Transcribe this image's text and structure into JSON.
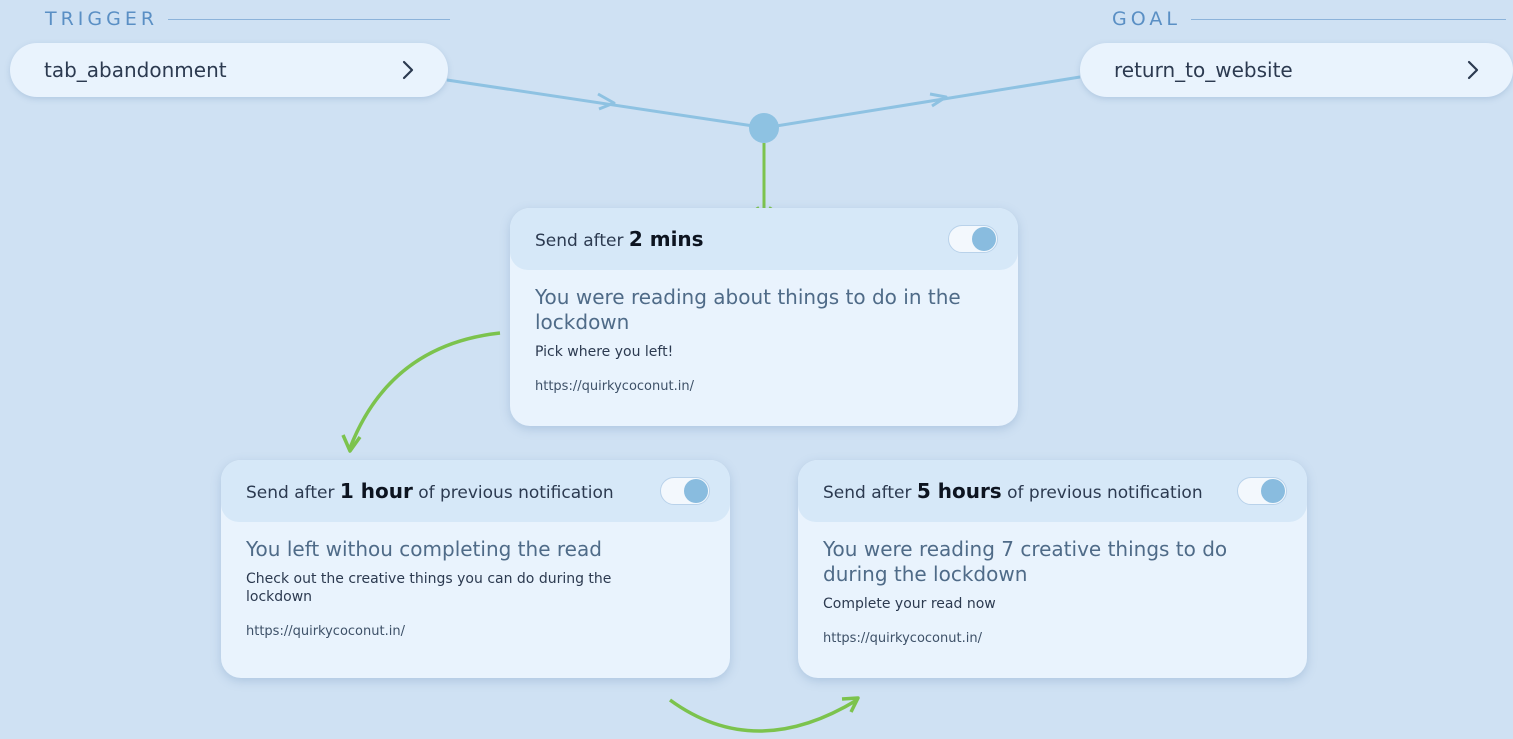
{
  "trigger": {
    "label": "TRIGGER",
    "value": "tab_abandonment"
  },
  "goal": {
    "label": "GOAL",
    "value": "return_to_website"
  },
  "notifications": [
    {
      "prefix": "Send after",
      "delay": "2 mins",
      "suffix": "",
      "title": "You were reading about things to do in the lockdown",
      "message": "Pick where you left!",
      "url": "https://quirkycoconut.in/",
      "enabled": true
    },
    {
      "prefix": "Send after",
      "delay": "1 hour",
      "suffix": "of previous notification",
      "title": "You left withou completing the read",
      "message": "Check out the creative things you can do during the lockdown",
      "url": "https://quirkycoconut.in/",
      "enabled": true
    },
    {
      "prefix": "Send after",
      "delay": "5 hours",
      "suffix": "of previous notification",
      "title": "You were reading 7 creative things to do during the lockdown",
      "message": "Complete your read now",
      "url": "https://quirkycoconut.in/",
      "enabled": true
    }
  ],
  "icons": {
    "pill_action": "chevron-right-icon",
    "junction": "junction-node-icon",
    "toggle": "toggle-switch-icon"
  },
  "colors": {
    "background": "#cfe1f3",
    "section_label": "#5a8fc4",
    "connector_blue": "#8ec2e2",
    "connector_green": "#7cc34d",
    "card": "#e9f3fd",
    "card_header": "#d6e8f8",
    "toggle_knob": "#89bcdf"
  }
}
